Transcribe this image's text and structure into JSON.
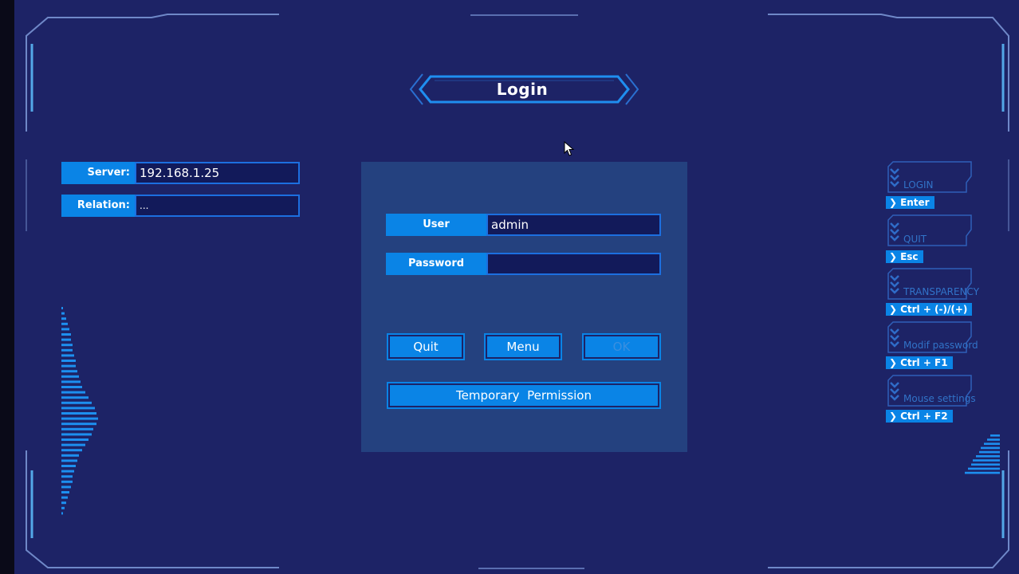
{
  "title": "Login",
  "server": {
    "label": "Server:",
    "value": "192.168.1.25"
  },
  "relation": {
    "label": "Relation:",
    "value": "..."
  },
  "login_form": {
    "user_label": "User",
    "user_value": "admin",
    "password_label": "Password",
    "password_value": "",
    "quit_label": "Quit",
    "menu_label": "Menu",
    "ok_label": "OK",
    "temp_permission_label": "Temporary  Permission"
  },
  "shortcuts": [
    {
      "label": "LOGIN",
      "key": "Enter"
    },
    {
      "label": "QUIT",
      "key": "Esc"
    },
    {
      "label": "TRANSPARENCY",
      "key": "Ctrl + (-)/(+)"
    },
    {
      "label": "Modif password",
      "key": "Ctrl + F1"
    },
    {
      "label": "Mouse settings",
      "key": "Ctrl + F2"
    }
  ],
  "colors": {
    "background": "#1d2366",
    "accent": "#0a84e6",
    "panel": "#24417f",
    "frame": "#6f88c8"
  }
}
